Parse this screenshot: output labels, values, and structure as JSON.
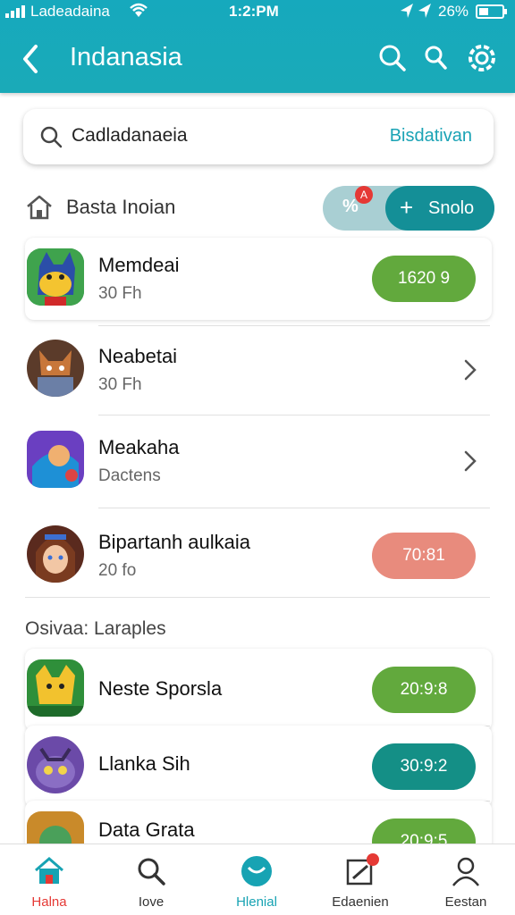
{
  "status": {
    "carrier": "Ladeadaina",
    "time": "1:2:PM",
    "battery": "26%"
  },
  "header": {
    "title": "Indanasia"
  },
  "search": {
    "placeholder": "Cadladanaeia",
    "action": "Bisdativan"
  },
  "section": {
    "title": "Basta Inoian",
    "toggle_off": "%",
    "toggle_badge": "A",
    "toggle_on": "Snolo"
  },
  "list": [
    {
      "name": "Memdeai",
      "sub": "30 Fh",
      "value": "1620 9",
      "color": "#62a93d"
    },
    {
      "name": "Neabetai",
      "sub": "30 Fh"
    },
    {
      "name": "Meakaha",
      "sub": "Dactens"
    },
    {
      "name": "Bipartanh aulkaia",
      "sub": "20 fo",
      "value": "70:81",
      "color": "#e88b7d"
    }
  ],
  "section2": {
    "label": "Osivaa:  Laraples"
  },
  "list2": [
    {
      "name": "Neste Sporsla",
      "value": "20:9:8",
      "color": "#62a93d"
    },
    {
      "name": "Llanka Sih",
      "value": "30:9:2",
      "color": "#148f86"
    },
    {
      "name": "Data Grata",
      "value": "20:9:5",
      "color": "#62a93d"
    }
  ],
  "tabs": [
    {
      "label": "Halna",
      "active": true
    },
    {
      "label": "Iove"
    },
    {
      "label": "Hlenial"
    },
    {
      "label": "Edaenien"
    },
    {
      "label": "Eestan"
    }
  ]
}
